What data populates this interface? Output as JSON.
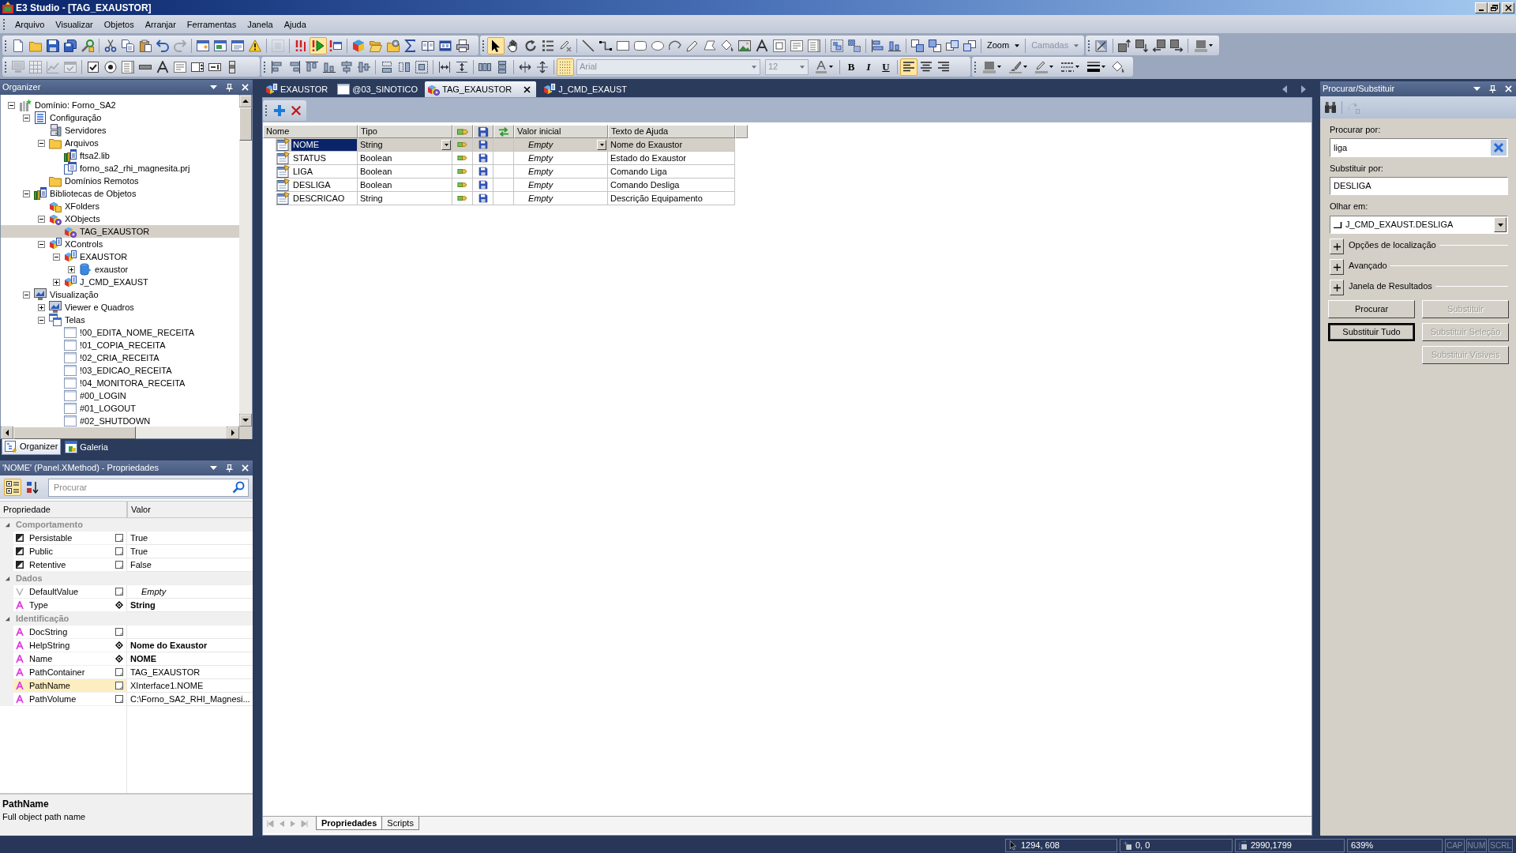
{
  "window": {
    "title": "E3 Studio - [TAG_EXAUSTOR]"
  },
  "menu": [
    "Arquivo",
    "Visualizar",
    "Objetos",
    "Arranjar",
    "Ferramentas",
    "Janela",
    "Ajuda"
  ],
  "toolbars": [
    [
      {
        "items": [
          {
            "kind": "button",
            "pressed": false,
            "disabled": false
          },
          {
            "kind": "button",
            "pressed": false,
            "disabled": false
          },
          {
            "kind": "button",
            "pressed": false,
            "disabled": false
          },
          {
            "kind": "button",
            "pressed": false,
            "disabled": false
          },
          {
            "kind": "button",
            "pressed": false,
            "disabled": false
          },
          {
            "kind": "separator"
          },
          {
            "kind": "button",
            "pressed": false,
            "disabled": false
          },
          {
            "kind": "button",
            "pressed": false,
            "disabled": false
          },
          {
            "kind": "button",
            "pressed": false,
            "disabled": false
          },
          {
            "kind": "button",
            "pressed": false,
            "disabled": false
          },
          {
            "kind": "button",
            "pressed": false,
            "disabled": true
          },
          {
            "kind": "separator"
          },
          {
            "kind": "button",
            "pressed": false,
            "disabled": false
          },
          {
            "kind": "button",
            "pressed": false,
            "disabled": false
          },
          {
            "kind": "button",
            "pressed": false,
            "disabled": false
          },
          {
            "kind": "button",
            "pressed": false,
            "disabled": false
          },
          {
            "kind": "separator"
          },
          {
            "kind": "button",
            "pressed": false,
            "disabled": true
          },
          {
            "kind": "separator"
          },
          {
            "kind": "button",
            "pressed": false,
            "disabled": false
          },
          {
            "kind": "button",
            "pressed": true,
            "disabled": false
          },
          {
            "kind": "button",
            "pressed": false,
            "disabled": false
          },
          {
            "kind": "separator"
          },
          {
            "kind": "button",
            "pressed": false,
            "disabled": false
          },
          {
            "kind": "button",
            "pressed": false,
            "disabled": false
          },
          {
            "kind": "button",
            "pressed": false,
            "disabled": false
          },
          {
            "kind": "button",
            "pressed": false,
            "disabled": false
          },
          {
            "kind": "button",
            "pressed": false,
            "disabled": false
          },
          {
            "kind": "button",
            "pressed": false,
            "disabled": false
          },
          {
            "kind": "button",
            "pressed": false,
            "disabled": false
          }
        ]
      },
      {
        "items": [
          {
            "kind": "button",
            "pressed": true,
            "disabled": false
          },
          {
            "kind": "button",
            "pressed": false,
            "disabled": false
          },
          {
            "kind": "button",
            "pressed": false,
            "disabled": false
          },
          {
            "kind": "button",
            "pressed": false,
            "disabled": false
          },
          {
            "kind": "button",
            "pressed": false,
            "disabled": false
          },
          {
            "kind": "separator"
          },
          {
            "kind": "button",
            "pressed": false,
            "disabled": false
          },
          {
            "kind": "button",
            "pressed": false,
            "disabled": false
          },
          {
            "kind": "button",
            "pressed": false,
            "disabled": false
          },
          {
            "kind": "button",
            "pressed": false,
            "disabled": false
          },
          {
            "kind": "button",
            "pressed": false,
            "disabled": false
          },
          {
            "kind": "button",
            "pressed": false,
            "disabled": false
          },
          {
            "kind": "button",
            "pressed": false,
            "disabled": false
          },
          {
            "kind": "button",
            "pressed": false,
            "disabled": false
          },
          {
            "kind": "button",
            "pressed": false,
            "disabled": false
          },
          {
            "kind": "button",
            "pressed": false,
            "disabled": false
          },
          {
            "kind": "button",
            "pressed": false,
            "disabled": false
          },
          {
            "kind": "button",
            "pressed": false,
            "disabled": false
          },
          {
            "kind": "button",
            "pressed": false,
            "disabled": false
          },
          {
            "kind": "button",
            "pressed": false,
            "disabled": false
          },
          {
            "kind": "separator"
          },
          {
            "kind": "button",
            "pressed": false,
            "disabled": false
          },
          {
            "kind": "button",
            "pressed": false,
            "disabled": false
          },
          {
            "kind": "separator"
          },
          {
            "kind": "button",
            "pressed": false,
            "disabled": false
          },
          {
            "kind": "button",
            "pressed": false,
            "disabled": false
          },
          {
            "kind": "separator"
          },
          {
            "kind": "button",
            "pressed": false,
            "disabled": false
          },
          {
            "kind": "button",
            "pressed": false,
            "disabled": false
          },
          {
            "kind": "button",
            "pressed": false,
            "disabled": false
          },
          {
            "kind": "button",
            "pressed": false,
            "disabled": false
          },
          {
            "kind": "separator"
          },
          {
            "kind": "dropdown",
            "label": "Zoom",
            "disabled": false
          },
          {
            "kind": "separator"
          },
          {
            "kind": "dropdown",
            "label": "Camadas",
            "disabled": true
          }
        ]
      },
      {
        "items": [
          {
            "kind": "button",
            "pressed": false,
            "disabled": false
          },
          {
            "kind": "separator"
          },
          {
            "kind": "button",
            "pressed": false,
            "disabled": false
          },
          {
            "kind": "button",
            "pressed": false,
            "disabled": false
          },
          {
            "kind": "button",
            "pressed": false,
            "disabled": false
          },
          {
            "kind": "button",
            "pressed": false,
            "disabled": false
          },
          {
            "kind": "separator"
          },
          {
            "kind": "split",
            "pressed": false,
            "disabled": false
          }
        ]
      }
    ],
    [
      {
        "items": [
          {
            "kind": "button",
            "pressed": false,
            "disabled": true
          },
          {
            "kind": "button",
            "pressed": false,
            "disabled": true
          },
          {
            "kind": "button",
            "pressed": false,
            "disabled": true
          },
          {
            "kind": "button",
            "pressed": false,
            "disabled": true
          },
          {
            "kind": "separator"
          },
          {
            "kind": "button",
            "pressed": false,
            "disabled": false
          },
          {
            "kind": "button",
            "pressed": false,
            "disabled": false
          },
          {
            "kind": "button",
            "pressed": false,
            "disabled": false
          },
          {
            "kind": "button",
            "pressed": false,
            "disabled": false
          },
          {
            "kind": "button",
            "pressed": false,
            "disabled": false
          },
          {
            "kind": "button",
            "pressed": false,
            "disabled": false
          },
          {
            "kind": "button",
            "pressed": false,
            "disabled": false
          },
          {
            "kind": "button",
            "pressed": false,
            "disabled": false
          },
          {
            "kind": "button",
            "pressed": false,
            "disabled": false
          }
        ]
      },
      {
        "items": [
          {
            "kind": "button",
            "pressed": false,
            "disabled": false
          },
          {
            "kind": "button",
            "pressed": false,
            "disabled": false
          },
          {
            "kind": "button",
            "pressed": false,
            "disabled": false
          },
          {
            "kind": "button",
            "pressed": false,
            "disabled": false
          },
          {
            "kind": "button",
            "pressed": false,
            "disabled": false
          },
          {
            "kind": "button",
            "pressed": false,
            "disabled": false
          },
          {
            "kind": "separator"
          },
          {
            "kind": "button",
            "pressed": false,
            "disabled": false
          },
          {
            "kind": "button",
            "pressed": false,
            "disabled": false
          },
          {
            "kind": "button",
            "pressed": false,
            "disabled": false
          },
          {
            "kind": "separator"
          },
          {
            "kind": "button",
            "pressed": false,
            "disabled": false
          },
          {
            "kind": "button",
            "pressed": false,
            "disabled": false
          },
          {
            "kind": "separator"
          },
          {
            "kind": "button",
            "pressed": false,
            "disabled": false
          },
          {
            "kind": "button",
            "pressed": false,
            "disabled": false
          },
          {
            "kind": "separator"
          },
          {
            "kind": "button",
            "pressed": false,
            "disabled": false
          },
          {
            "kind": "button",
            "pressed": false,
            "disabled": false
          },
          {
            "kind": "separator"
          },
          {
            "kind": "button",
            "pressed": true,
            "disabled": false
          },
          {
            "kind": "fontcombo",
            "value": "Arial",
            "disabled": true
          },
          {
            "kind": "sizecombo",
            "value": "12",
            "disabled": true
          },
          {
            "kind": "split",
            "pressed": false,
            "disabled": false
          },
          {
            "kind": "separator"
          },
          {
            "kind": "bold",
            "label": "B",
            "pressed": false
          },
          {
            "kind": "italic",
            "label": "I",
            "pressed": false
          },
          {
            "kind": "underline",
            "label": "U",
            "pressed": false
          },
          {
            "kind": "separator"
          },
          {
            "kind": "button",
            "pressed": true,
            "disabled": false
          },
          {
            "kind": "button",
            "pressed": false,
            "disabled": false
          },
          {
            "kind": "button",
            "pressed": false,
            "disabled": false
          }
        ]
      },
      {
        "items": [
          {
            "kind": "split",
            "pressed": false,
            "disabled": false
          },
          {
            "kind": "split",
            "pressed": false,
            "disabled": false
          },
          {
            "kind": "split",
            "pressed": false,
            "disabled": false
          },
          {
            "kind": "split",
            "pressed": false,
            "disabled": false
          },
          {
            "kind": "split",
            "pressed": false,
            "disabled": false
          },
          {
            "kind": "button",
            "pressed": false,
            "disabled": false
          }
        ]
      }
    ]
  ],
  "organizer": {
    "title": "Organizer",
    "tree": [
      {
        "label": "Domínio: Forno_SA2",
        "kind": "domain",
        "expanded": true,
        "selected": false,
        "children": [
          {
            "label": "Configuração",
            "kind": "config",
            "expanded": true,
            "selected": false,
            "children": [
              {
                "label": "Servidores",
                "kind": "servers",
                "selected": false
              },
              {
                "label": "Arquivos",
                "kind": "folder",
                "expanded": true,
                "selected": false,
                "children": [
                  {
                    "label": "ftsa2.lib",
                    "kind": "library",
                    "selected": false
                  },
                  {
                    "label": "forno_sa2_rhi_magnesita.prj",
                    "kind": "project",
                    "selected": false
                  }
                ]
              },
              {
                "label": "Domínios Remotos",
                "kind": "folder",
                "selected": false
              }
            ]
          },
          {
            "label": "Bibliotecas de Objetos",
            "kind": "library",
            "expanded": true,
            "selected": false,
            "children": [
              {
                "label": "XFolders",
                "kind": "xfolders",
                "selected": false
              },
              {
                "label": "XObjects",
                "kind": "xobjects",
                "expanded": true,
                "selected": false,
                "children": [
                  {
                    "label": "TAG_EXAUSTOR",
                    "kind": "xobjects",
                    "selected": true
                  }
                ]
              },
              {
                "label": "XControls",
                "kind": "xcontrols",
                "expanded": true,
                "selected": false,
                "children": [
                  {
                    "label": "EXAUSTOR",
                    "kind": "xcontrols",
                    "expanded": true,
                    "selected": false,
                    "children": [
                      {
                        "label": "exaustor",
                        "kind": "component",
                        "expanded": false,
                        "selected": false
                      }
                    ]
                  },
                  {
                    "label": "J_CMD_EXAUST",
                    "kind": "xcontrols",
                    "expanded": false,
                    "selected": false
                  }
                ]
              }
            ]
          },
          {
            "label": "Visualização",
            "kind": "viewer",
            "expanded": true,
            "selected": false,
            "children": [
              {
                "label": "Viewer e Quadros",
                "kind": "viewer",
                "expanded": false,
                "selected": false
              },
              {
                "label": "Telas",
                "kind": "screens",
                "expanded": true,
                "selected": false,
                "children": [
                  {
                    "label": "!00_EDITA_NOME_RECEITA",
                    "kind": "screen",
                    "selected": false
                  },
                  {
                    "label": "!01_COPIA_RECEITA",
                    "kind": "screen",
                    "selected": false
                  },
                  {
                    "label": "!02_CRIA_RECEITA",
                    "kind": "screen",
                    "selected": false
                  },
                  {
                    "label": "!03_EDICAO_RECEITA",
                    "kind": "screen",
                    "selected": false
                  },
                  {
                    "label": "!04_MONITORA_RECEITA",
                    "kind": "screen",
                    "selected": false
                  },
                  {
                    "label": "#00_LOGIN",
                    "kind": "screen",
                    "selected": false
                  },
                  {
                    "label": "#01_LOGOUT",
                    "kind": "screen",
                    "selected": false
                  },
                  {
                    "label": "#02_SHUTDOWN",
                    "kind": "screen",
                    "selected": false
                  }
                ]
              }
            ]
          }
        ]
      }
    ],
    "tabs": [
      {
        "label": "Organizer",
        "selected": true
      },
      {
        "label": "Galeria",
        "selected": false
      }
    ]
  },
  "properties": {
    "title": "'NOME' (Panel.XMethod) - Propriedades",
    "sort_modes": [
      {
        "kind": "categorized",
        "selected": true
      },
      {
        "kind": "alphabetical",
        "selected": false
      }
    ],
    "search": {
      "placeholder": "Procurar"
    },
    "columns": [
      "Propriedade",
      "Valor"
    ],
    "categories": [
      {
        "label": "Comportamento",
        "expanded": true,
        "rows": [
          {
            "name": "Persistable",
            "kind": "boolean",
            "modified": false,
            "value": "True",
            "selected": false
          },
          {
            "name": "Public",
            "kind": "boolean",
            "modified": false,
            "value": "True",
            "selected": false
          },
          {
            "name": "Retentive",
            "kind": "boolean",
            "modified": false,
            "value": "False",
            "selected": false
          }
        ]
      },
      {
        "label": "Dados",
        "expanded": true,
        "rows": [
          {
            "name": "DefaultValue",
            "kind": "variant",
            "modified": false,
            "value": "Empty",
            "selected": false
          },
          {
            "name": "Type",
            "kind": "string",
            "modified": true,
            "value": "String",
            "selected": false
          }
        ]
      },
      {
        "label": "Identificação",
        "expanded": true,
        "rows": [
          {
            "name": "DocString",
            "kind": "string",
            "modified": false,
            "selected": false
          },
          {
            "name": "HelpString",
            "kind": "string",
            "modified": true,
            "value": "Nome do Exaustor",
            "selected": false
          },
          {
            "name": "Name",
            "kind": "string",
            "modified": true,
            "value": "NOME",
            "selected": false
          },
          {
            "name": "PathContainer",
            "kind": "string",
            "modified": false,
            "value": "TAG_EXAUSTOR",
            "selected": false
          },
          {
            "name": "PathName",
            "kind": "string",
            "modified": false,
            "value": "XInterface1.NOME",
            "selected": true
          },
          {
            "name": "PathVolume",
            "kind": "string",
            "modified": false,
            "value": "C:\\Forno_SA2_RHI_Magnesi...",
            "selected": false
          }
        ]
      }
    ],
    "description": {
      "title": "PathName",
      "text": "Full object path name"
    }
  },
  "document_tabs": [
    {
      "label": "EXAUSTOR",
      "kind": "xcontrols",
      "selected": false
    },
    {
      "label": "@03_SINOTICO",
      "kind": "screen",
      "selected": false
    },
    {
      "label": "TAG_EXAUSTOR",
      "kind": "xobjects",
      "selected": true
    },
    {
      "label": "J_CMD_EXAUST",
      "kind": "xcontrols",
      "selected": false
    }
  ],
  "tag_table": {
    "columns": [
      {
        "kind": "text",
        "label": "Nome"
      },
      {
        "kind": "text",
        "label": "Tipo"
      },
      {
        "kind": "icon"
      },
      {
        "kind": "icon"
      },
      {
        "kind": "icon"
      },
      {
        "kind": "text",
        "label": "Valor inicial"
      },
      {
        "kind": "text",
        "label": "Texto de Ajuda"
      }
    ],
    "rows": [
      {
        "name": "NOME",
        "type": "String",
        "initial_value": "Empty",
        "help_text": "Nome do Exaustor",
        "selected": true
      },
      {
        "name": "STATUS",
        "type": "Boolean",
        "initial_value": "Empty",
        "help_text": "Estado do Exaustor",
        "selected": false
      },
      {
        "name": "LIGA",
        "type": "Boolean",
        "initial_value": "Empty",
        "help_text": "Comando Liga",
        "selected": false
      },
      {
        "name": "DESLIGA",
        "type": "Boolean",
        "initial_value": "Empty",
        "help_text": "Comando Desliga",
        "selected": false
      },
      {
        "name": "DESCRICAO",
        "type": "String",
        "initial_value": "Empty",
        "help_text": "Descrição Equipamento",
        "selected": false
      }
    ]
  },
  "bottom_tabs": [
    {
      "label": "Propriedades",
      "selected": true
    },
    {
      "label": "Scripts",
      "selected": false
    }
  ],
  "find_replace": {
    "title": "Procurar/Substituir",
    "tools": [
      {
        "disabled": false
      },
      {
        "disabled": true
      }
    ],
    "fields": [
      {
        "label": "Procurar por:",
        "kind": "search",
        "value": "liga"
      },
      {
        "label": "Substituir por:",
        "kind": "text",
        "value": "DESLIGA"
      },
      {
        "label": "Olhar em:",
        "kind": "dropdown",
        "value": "J_CMD_EXAUST.DESLIGA"
      }
    ],
    "sections": [
      {
        "label": "Opções de localização",
        "expanded": false
      },
      {
        "label": "Avançado",
        "expanded": false
      },
      {
        "label": "Janela de Resultados",
        "expanded": false
      }
    ],
    "buttons": [
      {
        "label": "Procurar",
        "disabled": false,
        "default": false
      },
      {
        "label": "Substituir",
        "disabled": true,
        "default": false
      },
      {
        "label": "Substituir Tudo",
        "disabled": false,
        "default": true
      },
      {
        "label": "Substituir Seleção",
        "disabled": true,
        "default": false
      },
      {
        "label": "Substituir Visíveis",
        "disabled": true,
        "default": false
      }
    ]
  },
  "status_bar": {
    "panels": [
      {
        "kind": "cursor",
        "text": "1294, 608"
      },
      {
        "kind": "position",
        "text": "0, 0"
      },
      {
        "kind": "size",
        "text": "2990,1799"
      },
      {
        "kind": "zoom",
        "text": "639%"
      }
    ],
    "indicators": [
      {
        "label": "CAP",
        "on": false
      },
      {
        "label": "NUM",
        "on": false
      },
      {
        "label": "SCRL",
        "on": false
      }
    ]
  }
}
